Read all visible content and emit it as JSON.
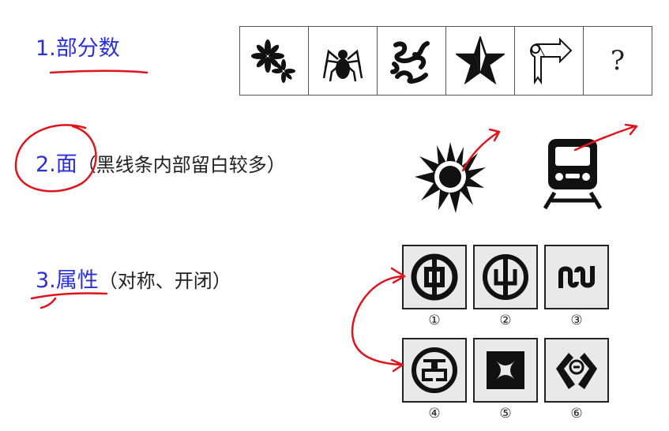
{
  "sections": [
    {
      "title": "1.部分数",
      "note": ""
    },
    {
      "title": "2.面",
      "note": "（黑线条内部留白较多）"
    },
    {
      "title": "3.属性",
      "note": "（对称、开闭）"
    }
  ],
  "figure_row": {
    "cells": [
      "asterisk-cluster",
      "spider",
      "swirl-knot",
      "star",
      "arrow-sign",
      "?"
    ]
  },
  "logos": {
    "labels": [
      "①",
      "②",
      "③",
      "④",
      "⑤",
      "⑥"
    ]
  },
  "colors": {
    "heading": "#2a2fd6",
    "annotation": "#e0141c",
    "ink": "#111111"
  }
}
